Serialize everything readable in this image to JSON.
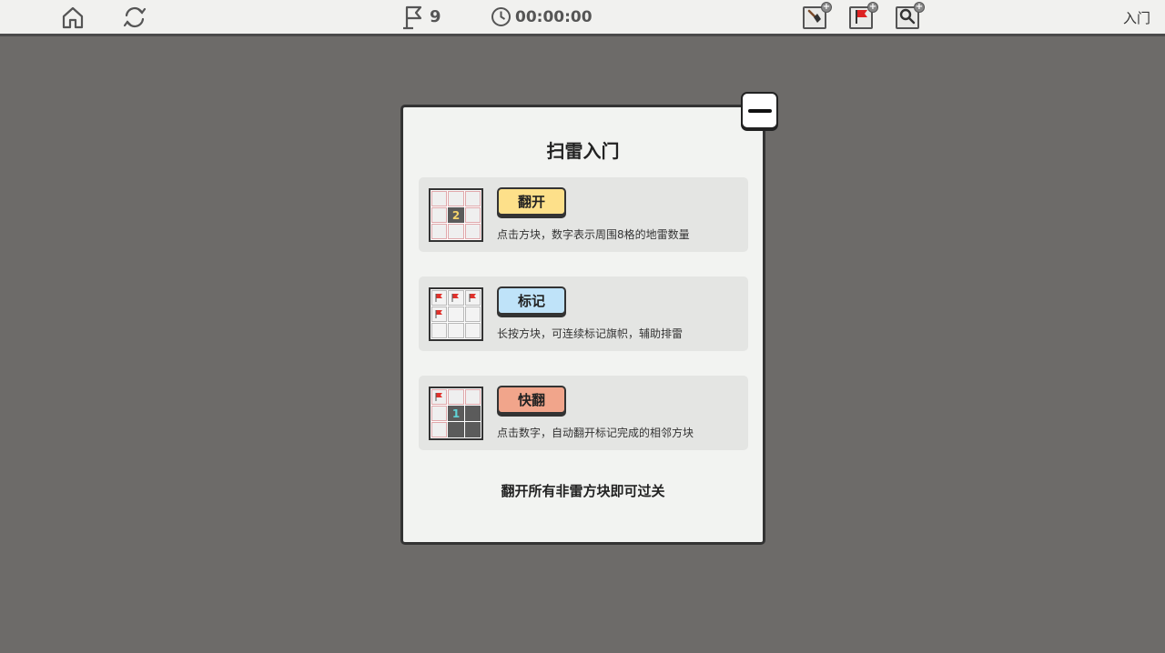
{
  "topbar": {
    "flag_count": "9",
    "timer": "00:00:00",
    "tutorial_label": "入门",
    "tools": [
      {
        "icon": "shovel-icon",
        "plus": "+"
      },
      {
        "icon": "red-flag-icon",
        "plus": "+"
      },
      {
        "icon": "magnifier-icon",
        "plus": "+"
      }
    ]
  },
  "modal": {
    "title": "扫雷入门",
    "cards": [
      {
        "button": "翻开",
        "description": "点击方块，数字表示周围8格的地雷数量",
        "number": "2"
      },
      {
        "button": "标记",
        "description": "长按方块，可连续标记旗帜，辅助排雷"
      },
      {
        "button": "快翻",
        "description": "点击数字，自动翻开标记完成的相邻方块",
        "number": "1"
      }
    ],
    "footer": "翻开所有非雷方块即可过关"
  },
  "colors": {
    "background": "#6d6b69",
    "modal_bg": "#f2f3f1",
    "btn_yellow": "#fde08a",
    "btn_blue": "#bfe3f9",
    "btn_salmon": "#f1a58b",
    "number_yellow": "#f5d36a",
    "number_teal": "#5fd3d6",
    "flag_red": "#e0322c"
  }
}
